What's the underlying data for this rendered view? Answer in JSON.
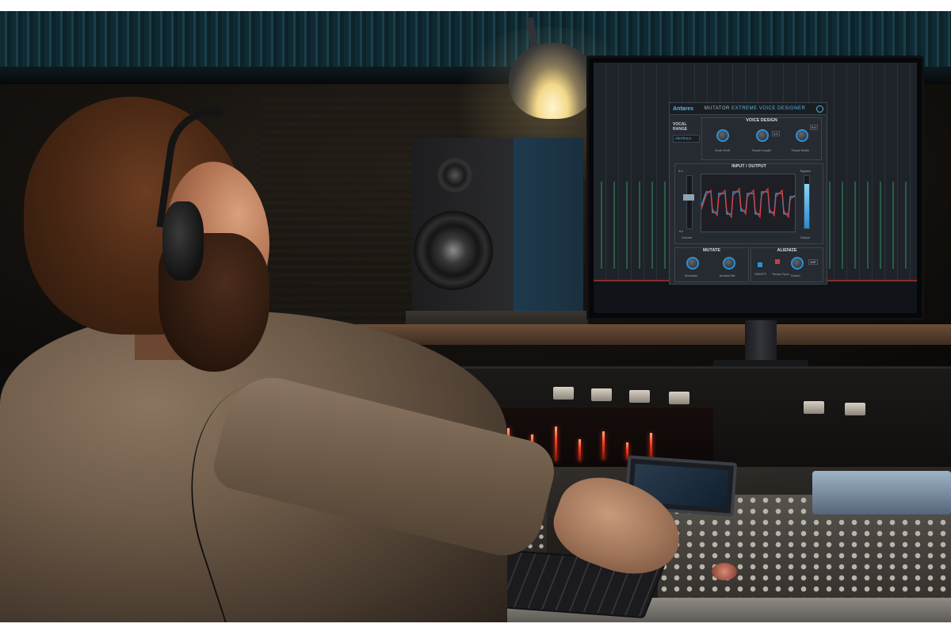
{
  "scene": {
    "description_icons": [
      "person-icon",
      "headphones-icon",
      "mixing-console-icon",
      "monitor-icon",
      "studio-speaker-icon",
      "desk-lamp-icon",
      "keyboard-icon"
    ]
  },
  "plugin": {
    "logo": "Antares",
    "title": "MUTATOR",
    "subtitle": "EXTREME VOICE DESIGNER",
    "voice_design": {
      "title": "VOICE DESIGN",
      "vocal_range_label": "VOCAL RANGE",
      "vocal_range_value": "Alto/Tenor",
      "knobs": [
        {
          "label": "Grain Shift"
        },
        {
          "label": "Throat Length",
          "value": "1.0"
        },
        {
          "label": "Throat Width",
          "value": "0.0"
        }
      ]
    },
    "io": {
      "title": "INPUT / OUTPUT",
      "volume_label": "Volume",
      "bypass_label": "Bypass",
      "output_label": "Output",
      "left_readout": "0.0",
      "low_readout": "-inf"
    },
    "mutate": {
      "title": "MUTATE",
      "knobs": [
        {
          "label": "Modulate"
        },
        {
          "label": "Mutant Mix"
        }
      ]
    },
    "alienize": {
      "title": "ALIENIZE",
      "onoff_label": "ON/OFF",
      "tempo_label": "Tempo Sync",
      "knob_label": "Distort",
      "value": "1/8T"
    }
  }
}
